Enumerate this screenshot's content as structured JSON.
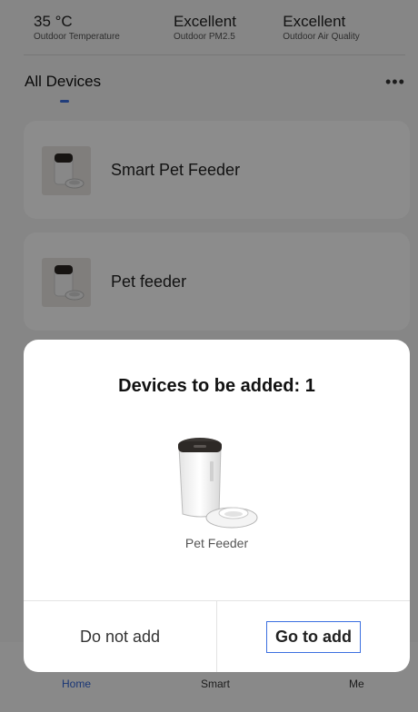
{
  "weather": {
    "temperature": {
      "value": "35 °C",
      "label": "Outdoor Temperature"
    },
    "pm25": {
      "value": "Excellent",
      "label": "Outdoor PM2.5"
    },
    "air_quality": {
      "value": "Excellent",
      "label": "Outdoor Air Quality"
    }
  },
  "devices": {
    "title": "All Devices",
    "more_icon": "more-dots-icon",
    "items": [
      {
        "name": "Smart Pet Feeder",
        "icon": "pet-feeder-icon"
      },
      {
        "name": "Pet feeder",
        "icon": "pet-feeder-icon"
      }
    ]
  },
  "tabbar": {
    "home": "Home",
    "smart": "Smart",
    "me": "Me",
    "active_color": "#2f63d6"
  },
  "dialog": {
    "title": "Devices to be added: 1",
    "device_name": "Pet Feeder",
    "device_icon": "pet-feeder-icon",
    "cancel_label": "Do not add",
    "confirm_label": "Go to add"
  }
}
